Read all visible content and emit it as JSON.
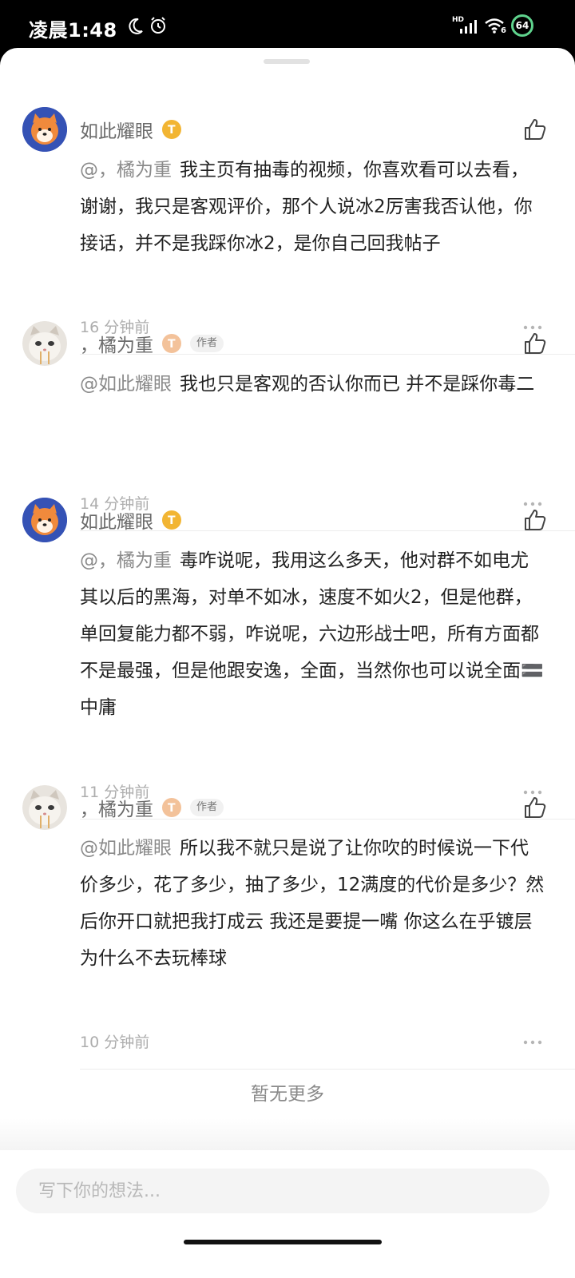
{
  "status_bar": {
    "time": "凌晨1:48",
    "network": "HD",
    "wifi_badge": "6",
    "battery": "64"
  },
  "comments": [
    {
      "user": "如此耀眼",
      "level_letter": "T",
      "author_tag": "",
      "mention": "@，橘为重",
      "text": "我主页有抽毒的视频，你喜欢看可以去看，谢谢，我只是客观评价，那个人说冰2厉害我否认他，你接话，并不是我踩你冰2，是你自己回我帖子",
      "time": "16 分钟前"
    },
    {
      "user": "，橘为重",
      "level_letter": "T",
      "author_tag": "作者",
      "mention": "@如此耀眼",
      "text": "我也只是客观的否认你而已 并不是踩你毒二",
      "time": "14 分钟前"
    },
    {
      "user": "如此耀眼",
      "level_letter": "T",
      "author_tag": "",
      "mention": "@，橘为重",
      "text": "毒咋说呢，我用这么多天，他对群不如电尤其以后的黑海，对单不如冰，速度不如火2，但是他群，单回复能力都不弱，咋说呢，六边形战士吧，所有方面都不是最强，但是他跟安逸，全面，当然你也可以说全面🟰中庸",
      "time": "11 分钟前"
    },
    {
      "user": "，橘为重",
      "level_letter": "T",
      "author_tag": "作者",
      "mention": "@如此耀眼",
      "text": "所以我不就只是说了让你吹的时候说一下代价多少，花了多少，抽了多少，12满度的代价是多少？然后你开口就把我打成云 我还是要提一嘴 你这么在乎镀层 为什么不去玩棒球",
      "time": "10 分钟前"
    }
  ],
  "no_more": "暂无更多",
  "input": {
    "placeholder": "写下你的想法..."
  }
}
